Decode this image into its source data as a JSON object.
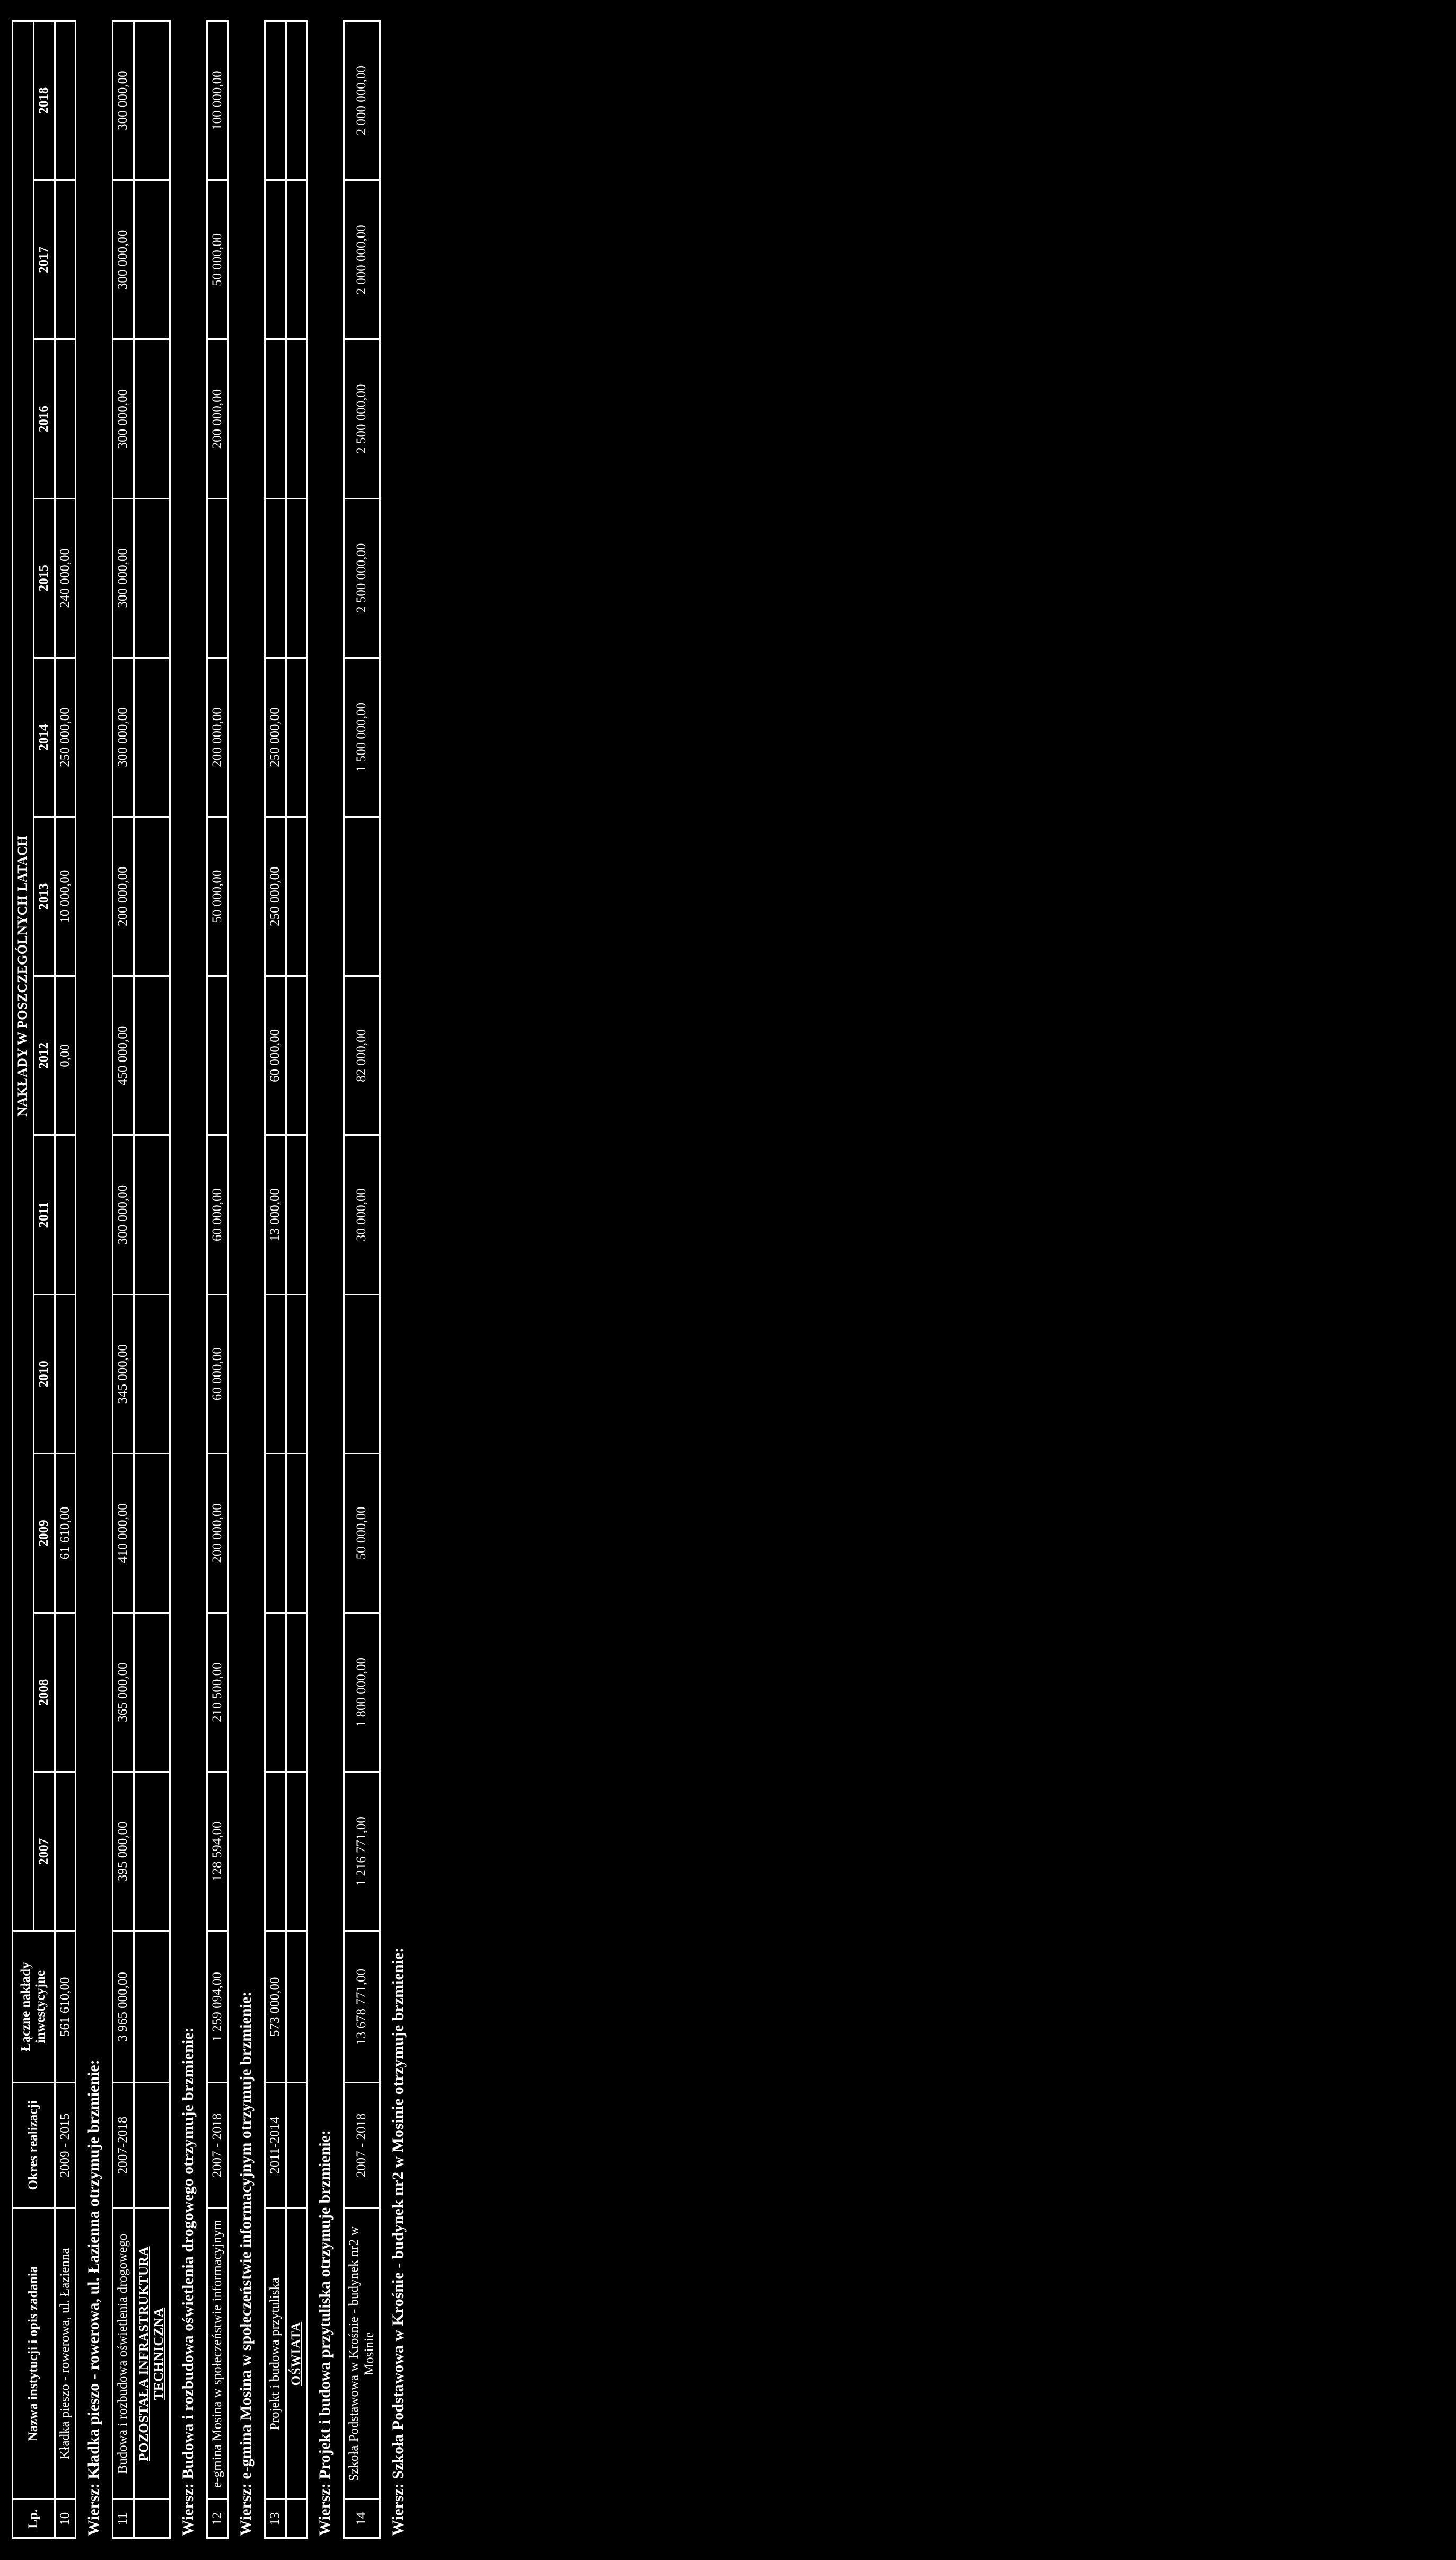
{
  "document": {
    "orientation": "rotated-90-ccw",
    "render": "inverted-scan-white-on-black"
  },
  "table": {
    "columns": {
      "lp": "Lp.",
      "name": "Nazwa instytucji i opis zadania",
      "okres": "Okres realizacji",
      "total": "Łączne nakłady inwestycyjne",
      "years_title": "NAKŁADY W POSZCZEGÓLNYCH LATACH"
    },
    "years": [
      "2007",
      "2008",
      "2009",
      "2010",
      "2011",
      "2012",
      "2013",
      "2014",
      "2015",
      "2016",
      "2017",
      "2018"
    ],
    "sections": {
      "infra": "POZOSTAŁA INFRASTRUKTURA TECHNICZNA",
      "oswiata": "OŚWIATA"
    },
    "rows": [
      {
        "lp": "10",
        "name": "Kładka pieszo - rowerowa, ul. Łazienna",
        "okres": "2009 - 2015",
        "total": "561 610,00",
        "values": [
          "",
          "",
          "61 610,00",
          "",
          "",
          "0,00",
          "10 000,00",
          "250 000,00",
          "240 000,00",
          "",
          "",
          ""
        ],
        "note": "Wiersz: Kładka pieszo - rowerowa, ul. Łazienna otrzymuje brzmienie:"
      },
      {
        "lp": "11",
        "name": "Budowa i rozbudowa oświetlenia drogowego",
        "okres": "2007-2018",
        "total": "3 965 000,00",
        "values": [
          "395 000,00",
          "365 000,00",
          "410 000,00",
          "345 000,00",
          "300 000,00",
          "450 000,00",
          "200 000,00",
          "300 000,00",
          "300 000,00",
          "300 000,00",
          "300 000,00",
          "300 000,00"
        ],
        "note": "Wiersz: Budowa i rozbudowa oświetlenia drogowego otrzymuje brzmienie:"
      },
      {
        "lp": "12",
        "name": "e-gmina Mosina w społeczeństwie informacyjnym",
        "okres": "2007 - 2018",
        "total": "1 259 094,00",
        "values": [
          "128 594,00",
          "210 500,00",
          "200 000,00",
          "60 000,00",
          "60 000,00",
          "",
          "50 000,00",
          "200 000,00",
          "",
          "200 000,00",
          "50 000,00",
          "100 000,00"
        ],
        "note": "Wiersz: e-gmina Mosina w społeczeństwie informacyjnym otrzymuje brzmienie:"
      },
      {
        "lp": "13",
        "name": "Projekt i budowa przytuliska",
        "okres": "2011-2014",
        "total": "573 000,00",
        "values": [
          "",
          "",
          "",
          "",
          "13 000,00",
          "60 000,00",
          "250 000,00",
          "250 000,00",
          "",
          "",
          "",
          ""
        ],
        "note": "Wiersz: Projekt i budowa przytuliska otrzymuje brzmienie:"
      },
      {
        "lp": "14",
        "name": "Szkoła Podstawowa w Krośnie - budynek nr2 w Mosinie",
        "okres": "2007 - 2018",
        "total": "13 678 771,00",
        "values": [
          "1 216 771,00",
          "1 800 000,00",
          "50 000,00",
          "",
          "30 000,00",
          "82 000,00",
          "",
          "1 500 000,00",
          "2 500 000,00",
          "2 500 000,00",
          "2 000 000,00",
          "2 000 000,00"
        ],
        "note": "Wiersz: Szkoła Podstawowa w Krośnie - budynek nr2 w Mosinie otrzymuje brzmienie:"
      }
    ]
  }
}
